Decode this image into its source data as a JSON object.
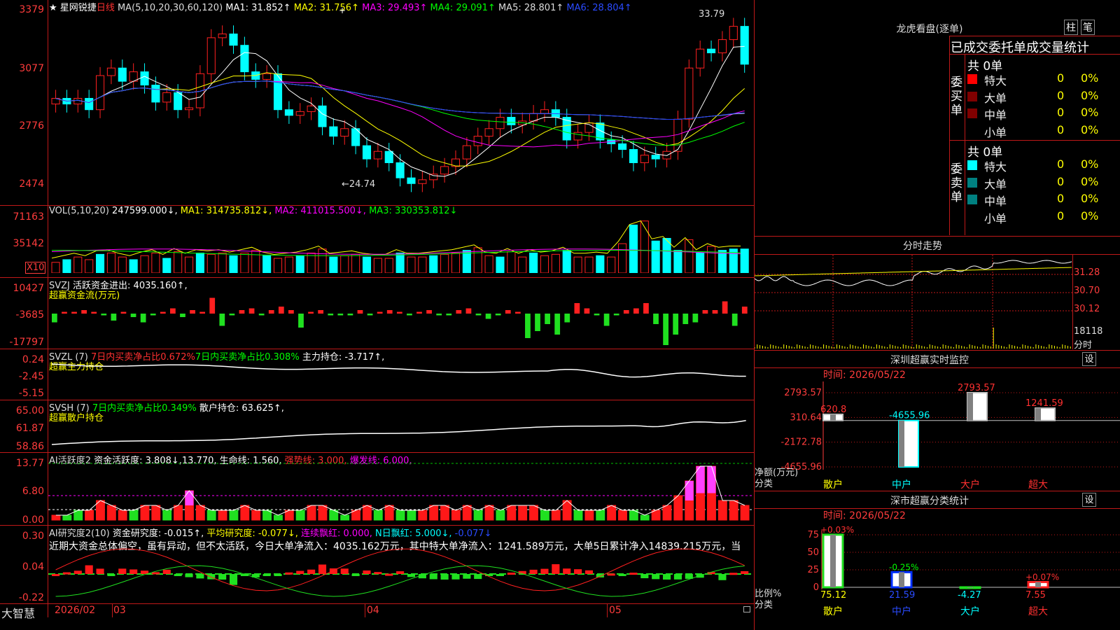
{
  "colors": {
    "up": "#ff2020",
    "down": "#00ffff",
    "ma1": "#ffffff",
    "ma2": "#ffff00",
    "ma3": "#ff00ff",
    "ma4": "#00ff00",
    "ma5": "#ffffff",
    "ma6": "#2040ff",
    "grid": "#c01818",
    "axis": "#ff3c3c"
  },
  "main_panel": {
    "star": "★",
    "stock_name": "星网锐捷",
    "period": "日线",
    "ma_label": "MA(5,10,20,30,60,120)",
    "ma1": "MA1: 31.852↑",
    "ma2": "MA2: 31.756↑",
    "ma3": "MA3: 29.493↑",
    "ma4": "MA4: 29.091↑",
    "ma5": "MA5: 28.801↑",
    "ma6": "MA6: 28.804↑",
    "y_ticks": [
      "3379",
      "3077",
      "2776",
      "2474"
    ],
    "high_label": "33.79",
    "low_label": "←24.74",
    "cursor_mark": "+"
  },
  "vol_panel": {
    "label": "VOL(5,10,20)",
    "value": "247599.000↓,",
    "ma1": "MA1: 314735.812↓,",
    "ma2": "MA2: 411015.500↓,",
    "ma3": "MA3: 330353.812↓",
    "y_ticks": [
      "71163",
      "35142"
    ],
    "unit": "X10",
    "values": [
      8,
      10,
      12,
      10,
      14,
      15,
      12,
      10,
      13,
      15,
      11,
      16,
      12,
      15,
      14,
      15,
      13,
      15,
      17,
      13,
      11,
      12,
      13,
      15,
      18,
      12,
      13,
      14,
      12,
      11,
      11,
      15,
      12,
      12,
      13,
      14,
      15,
      17,
      19,
      13,
      12,
      16,
      12,
      15,
      13,
      14,
      17,
      12,
      12,
      13,
      12,
      22,
      36,
      39,
      24,
      26,
      17,
      25,
      15,
      20,
      17,
      18,
      18
    ]
  },
  "svzj_panel": {
    "label": "SVZJ",
    "title": "活跃资金进出: 4035.160↑,",
    "sub": "超赢资金流(万元)",
    "y_ticks": [
      "10427",
      "-3685",
      "-17797"
    ],
    "values": [
      -2.5,
      0.5,
      0.5,
      1,
      0.5,
      -0.5,
      -2,
      0.5,
      -1,
      -2.5,
      -0.5,
      0.5,
      1.5,
      -1,
      1,
      0.5,
      4.5,
      -3.5,
      -0.5,
      1,
      1.5,
      -0.5,
      1,
      2,
      1,
      -4,
      0.5,
      1,
      -0.5,
      -0.5,
      -0.5,
      1,
      -0.5,
      0.5,
      1,
      0.5,
      -0.5,
      0.5,
      1,
      -0.5,
      -0.5,
      1,
      1.5,
      -0.5,
      -1.5,
      -0.5,
      1,
      0.5,
      -7,
      -5,
      -3,
      -6,
      -2.5,
      3,
      1.5,
      -0.5,
      -3.5,
      -0.5,
      1,
      1.5,
      3,
      -3,
      -9,
      -6,
      -3,
      -2.5,
      1,
      1,
      3.5,
      -3.5,
      2
    ]
  },
  "svzl_panel": {
    "label": "SVZL (7)",
    "text1": "7日内买卖净占比0.672%",
    "text2": "7日内买卖净占比0.308%",
    "text3": "主力持仓: -3.717↑,",
    "sub": "超赢主力持仓",
    "y_ticks": [
      "0.24",
      "-2.45",
      "-5.15"
    ]
  },
  "svsh_panel": {
    "label": "SVSH (7)",
    "text1": "7日内买卖净占比0.349%",
    "text2": "散户持仓: 63.625↑,",
    "sub": "超赢散户持仓",
    "y_ticks": [
      "65.00",
      "61.87",
      "58.86"
    ]
  },
  "ai_active_panel": {
    "label": "AI活跃度2",
    "t1": "资金活跃度: 3.808↓,13.770,",
    "t2": "生命线: 1.560,",
    "t3": "强势线: 3.000,",
    "t4": "爆发线: 6.000,",
    "y_ticks": [
      "13.77",
      "6.80",
      "0.00"
    ]
  },
  "ai_research_panel": {
    "label": "AI研究度2(10)",
    "t1": "资金研究度: -0.015↑,",
    "t2": "平均研究度: -0.077↓,",
    "t3": "连续飘红: 0.000,",
    "t4": "N日飘红: 5.000↓,",
    "t5": "-0.077↓",
    "commentary": "近期大资金总体偏空，虽有异动，但不太活跃，今日大单净流入：4035.162万元，其中特大单净流入：1241.589万元，大单5日累计净入14839.215万元，当",
    "y_ticks": [
      "0.30",
      "0.04",
      "-0.22"
    ]
  },
  "bottom_bar": {
    "brand": "大智慧",
    "dates": [
      "2026/02",
      "03",
      "04",
      "05"
    ]
  },
  "dragon_tiger": {
    "title": "龙虎看盘(逐单)",
    "btn1": "柱",
    "btn2": "笔",
    "tabs": [
      "已成交",
      "委托单",
      "成交量统计"
    ],
    "buy_label": "委买单",
    "sell_label": "委卖单",
    "buy_total": "共 0单",
    "sell_total": "共 0单",
    "rows": [
      {
        "label": "特大",
        "value": "0",
        "pct": "0%"
      },
      {
        "label": "大单",
        "value": "0",
        "pct": "0%"
      },
      {
        "label": "中单",
        "value": "0",
        "pct": "0%"
      },
      {
        "label": "小单",
        "value": "0",
        "pct": "0%"
      }
    ],
    "buy_colors": [
      "#ff0000",
      "#800000",
      "#800000",
      ""
    ],
    "sell_colors": [
      "#00ffff",
      "#008080",
      "#008080",
      ""
    ]
  },
  "intraday": {
    "title": "分时走势",
    "y_ticks": [
      "31.28",
      "30.70",
      "30.12"
    ],
    "vol_tick": "18118",
    "vol_label": "分时"
  },
  "sz_monitor": {
    "title": "深圳超赢实时监控",
    "gear": "设",
    "date": "时间: 2026/05/22",
    "y_ticks": [
      "2793.57",
      "310.64",
      "-2172.78",
      "-4655.96"
    ],
    "ylabel": "净额(万元)",
    "xlabel": "分类",
    "categories": [
      "散户",
      "中户",
      "大户",
      "超大"
    ],
    "values": [
      620.8,
      -4655.96,
      2793.57,
      1241.59
    ],
    "labels": [
      "620.8",
      "-4655.96",
      "2793.57",
      "1241.59"
    ]
  },
  "sz_class": {
    "title": "深市超赢分类统计",
    "gear": "设",
    "date": "时间: 2026/05/22",
    "y_ticks": [
      "75",
      "50",
      "25",
      "0"
    ],
    "ylabel": "比例%",
    "xlabel": "分类",
    "categories": [
      "散户",
      "中户",
      "大户",
      "超大"
    ],
    "values": [
      75.12,
      21.59,
      -4.27,
      7.55
    ],
    "value_labels": [
      "75.12",
      "21.59",
      "-4.27",
      "7.55"
    ],
    "change_labels": [
      "+0.03%",
      "-0.25%",
      "",
      "+0.07%"
    ]
  }
}
